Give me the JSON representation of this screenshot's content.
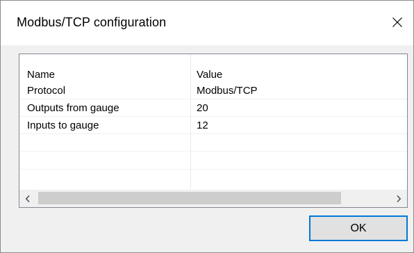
{
  "window": {
    "title": "Modbus/TCP configuration",
    "close_icon": "close-icon"
  },
  "table": {
    "columns": [
      "Name",
      "Value"
    ],
    "rows": [
      {
        "name": "Protocol",
        "value": "Modbus/TCP"
      },
      {
        "name": "Outputs from gauge",
        "value": "20"
      },
      {
        "name": "Inputs to gauge",
        "value": "12"
      },
      {
        "name": "",
        "value": ""
      },
      {
        "name": "",
        "value": ""
      },
      {
        "name": "",
        "value": ""
      }
    ]
  },
  "scrollbar": {
    "left_icon": "chevron-left-icon",
    "right_icon": "chevron-right-icon"
  },
  "buttons": {
    "ok_label": "OK"
  },
  "colors": {
    "accent": "#0078d7",
    "dialog_bg": "#f0f0f0",
    "button_bg": "#e1e1e1"
  }
}
